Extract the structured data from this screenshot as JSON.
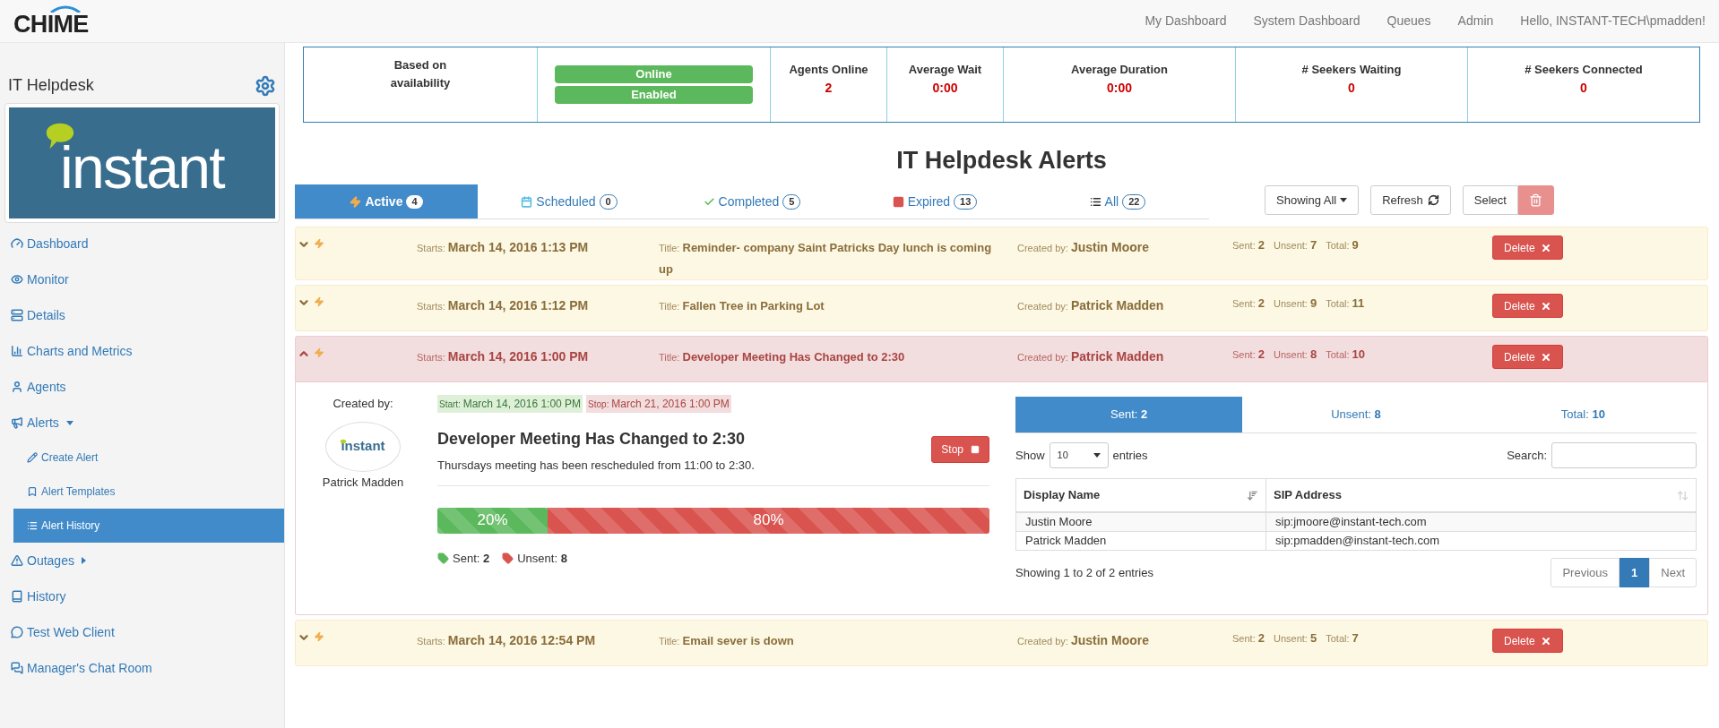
{
  "nav": {
    "logo": "CHIME",
    "links": [
      "My Dashboard",
      "System Dashboard",
      "Queues",
      "Admin"
    ],
    "greeting": "Hello, INSTANT-TECH\\pmadden!"
  },
  "sidebar": {
    "title": "IT Helpdesk",
    "logo": "instant",
    "items": [
      {
        "label": "Dashboard",
        "selected": false
      },
      {
        "label": "Monitor",
        "selected": false
      },
      {
        "label": "Details",
        "selected": false
      },
      {
        "label": "Charts and Metrics",
        "selected": false
      },
      {
        "label": "Agents",
        "selected": false
      },
      {
        "label": "Alerts",
        "selected": false,
        "expanded": true,
        "children": [
          {
            "label": "Create Alert",
            "selected": false
          },
          {
            "label": "Alert Templates",
            "selected": false
          },
          {
            "label": "Alert History",
            "selected": true
          }
        ]
      },
      {
        "label": "Outages",
        "selected": false,
        "expanded": false
      },
      {
        "label": "History",
        "selected": false
      },
      {
        "label": "Test Web Client",
        "selected": false
      },
      {
        "label": "Manager's Chat Room",
        "selected": false
      }
    ]
  },
  "stats": {
    "basis": "Based on availability",
    "statuses": [
      "Online",
      "Enabled"
    ],
    "metrics": [
      {
        "label": "Agents Online",
        "value": "2"
      },
      {
        "label": "Average Wait",
        "value": "0:00"
      },
      {
        "label": "Average Duration",
        "value": "0:00"
      },
      {
        "label": "# Seekers Waiting",
        "value": "0"
      },
      {
        "label": "# Seekers Connected",
        "value": "0"
      }
    ]
  },
  "page_title": "IT Helpdesk Alerts",
  "tabs": [
    {
      "label": "Active",
      "count": "4",
      "selected": true
    },
    {
      "label": "Scheduled",
      "count": "0",
      "selected": false
    },
    {
      "label": "Completed",
      "count": "5",
      "selected": false
    },
    {
      "label": "Expired",
      "count": "13",
      "selected": false
    },
    {
      "label": "All",
      "count": "22",
      "selected": false
    }
  ],
  "toolbar": {
    "filter": "Showing All",
    "refresh": "Refresh",
    "select": "Select"
  },
  "alerts": [
    {
      "expanded": false,
      "starts": {
        "label": "Starts:",
        "value": "March 14, 2016 1:13 PM"
      },
      "title": {
        "label": "Title:",
        "value": "Reminder- company Saint Patricks Day lunch is coming up"
      },
      "created_by": {
        "label": "Created by:",
        "value": "Justin Moore"
      },
      "counts": [
        {
          "label": "Sent:",
          "value": "2"
        },
        {
          "label": "Unsent:",
          "value": "7"
        },
        {
          "label": "Total:",
          "value": "9"
        }
      ],
      "delete": "Delete"
    },
    {
      "expanded": false,
      "starts": {
        "label": "Starts:",
        "value": "March 14, 2016 1:12 PM"
      },
      "title": {
        "label": "Title:",
        "value": "Fallen Tree in Parking Lot"
      },
      "created_by": {
        "label": "Created by:",
        "value": "Patrick Madden"
      },
      "counts": [
        {
          "label": "Sent:",
          "value": "2"
        },
        {
          "label": "Unsent:",
          "value": "9"
        },
        {
          "label": "Total:",
          "value": "11"
        }
      ],
      "delete": "Delete"
    },
    {
      "expanded": true,
      "starts": {
        "label": "Starts:",
        "value": "March 14, 2016 1:00 PM"
      },
      "title": {
        "label": "Title:",
        "value": "Developer Meeting Has Changed to 2:30"
      },
      "created_by": {
        "label": "Created by:",
        "value": "Patrick Madden"
      },
      "counts": [
        {
          "label": "Sent:",
          "value": "2"
        },
        {
          "label": "Unsent:",
          "value": "8"
        },
        {
          "label": "Total:",
          "value": "10"
        }
      ],
      "delete": "Delete",
      "detail": {
        "created_by_label": "Created by:",
        "avatar_logo": "instant",
        "author": "Patrick Madden",
        "start": {
          "label": "Start:",
          "value": "March 14, 2016 1:00 PM"
        },
        "stop": {
          "label": "Stop:",
          "value": "March 21, 2016 1:00 PM"
        },
        "heading": "Developer Meeting Has Changed to 2:30",
        "message": "Thursdays meeting has been rescheduled from 11:00 to 2:30.",
        "stop_button": "Stop",
        "progress": [
          {
            "kind": "sent",
            "label": "20%",
            "level": 0.2
          },
          {
            "kind": "unsent",
            "label": "80%",
            "level": 0.8
          }
        ],
        "legend": [
          {
            "kind": "sent",
            "label": "Sent:",
            "value": "2"
          },
          {
            "kind": "unsent",
            "label": "Unsent:",
            "value": "8"
          }
        ],
        "sub_tabs": [
          {
            "label": "Sent:",
            "count": "2",
            "selected": true
          },
          {
            "label": "Unsent:",
            "count": "8",
            "selected": false
          },
          {
            "label": "Total:",
            "count": "10",
            "selected": false
          }
        ],
        "table": {
          "show_label": "Show",
          "page_size": "10",
          "entries_label": "entries",
          "search_label": "Search:",
          "columns": [
            {
              "label": "Display Name",
              "sorted": true
            },
            {
              "label": "SIP Address",
              "sorted": false
            }
          ],
          "rows": [
            [
              "Justin Moore",
              "sip:jmoore@instant-tech.com"
            ],
            [
              "Patrick Madden",
              "sip:pmadden@instant-tech.com"
            ]
          ],
          "info": "Showing 1 to 2 of 2 entries",
          "pages": [
            {
              "label": "Previous",
              "selected": false
            },
            {
              "label": "1",
              "selected": true
            },
            {
              "label": "Next",
              "selected": false
            }
          ]
        }
      }
    },
    {
      "expanded": false,
      "starts": {
        "label": "Starts:",
        "value": "March 14, 2016 12:54 PM"
      },
      "title": {
        "label": "Title:",
        "value": "Email sever is down"
      },
      "created_by": {
        "label": "Created by:",
        "value": "Justin Moore"
      },
      "counts": [
        {
          "label": "Sent:",
          "value": "2"
        },
        {
          "label": "Unsent:",
          "value": "5"
        },
        {
          "label": "Total:",
          "value": "7"
        }
      ],
      "delete": "Delete"
    }
  ]
}
